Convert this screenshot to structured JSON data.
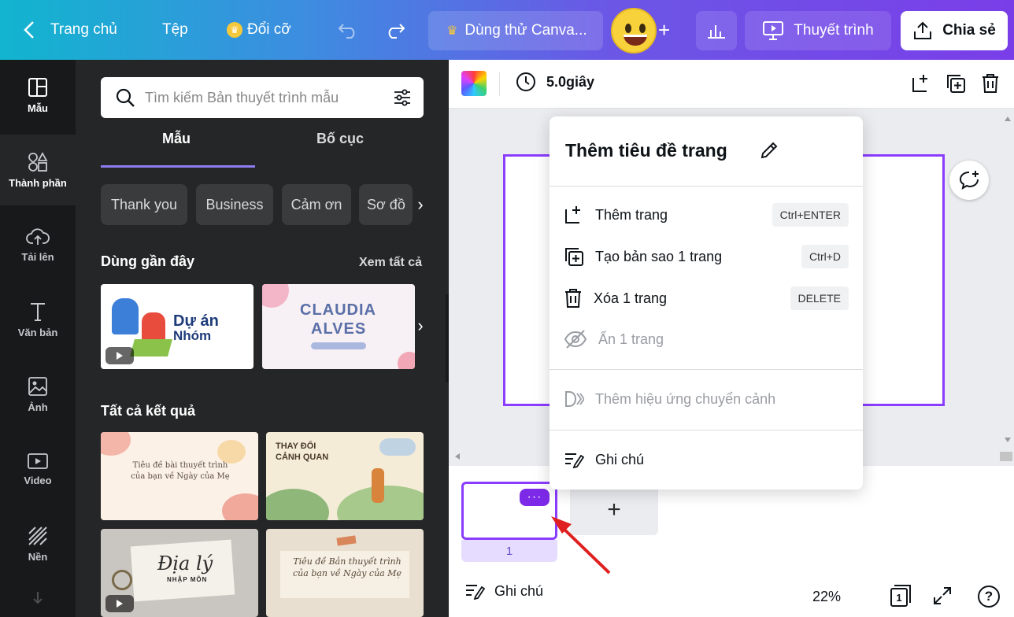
{
  "topbar": {
    "home_label": "Trang chủ",
    "file_label": "Tệp",
    "resize_label": "Đổi cỡ",
    "trial_label": "Dùng thử Canva...",
    "present_label": "Thuyết trình",
    "share_label": "Chia sẻ"
  },
  "rail": {
    "items": [
      {
        "label": "Mẫu",
        "icon": "template-icon"
      },
      {
        "label": "Thành phần",
        "icon": "elements-icon"
      },
      {
        "label": "Tải lên",
        "icon": "upload-icon"
      },
      {
        "label": "Văn bản",
        "icon": "text-icon"
      },
      {
        "label": "Ảnh",
        "icon": "photo-icon"
      },
      {
        "label": "Video",
        "icon": "video-icon"
      },
      {
        "label": "Nền",
        "icon": "background-icon"
      }
    ]
  },
  "panel": {
    "search_placeholder": "Tìm kiếm Bản thuyết trình mẫu",
    "tabs": [
      "Mẫu",
      "Bố cục"
    ],
    "chips": [
      "Thank you",
      "Business",
      "Cảm ơn",
      "Sơ đồ"
    ],
    "recent_title": "Dùng gần đây",
    "see_all": "Xem tất cả",
    "all_results_title": "Tất cả kết quả",
    "thumbs": {
      "t1_line1": "Dự án",
      "t1_line2": "Nhóm",
      "t2_line1": "CLAUDIA",
      "t2_line2": "ALVES",
      "t3_text": "Tiêu đề bài thuyết trình của bạn về Ngày của Mẹ",
      "t4_line1": "THAY ĐỔI",
      "t4_line2": "CẢNH QUAN",
      "t5_line1": "Địa lý",
      "t5_line2": "NHẬP MÔN",
      "t6_text": "Tiêu đề Bản thuyết trình của bạn về Ngày của Mẹ"
    }
  },
  "toolbar": {
    "duration": "5.0giây"
  },
  "menu": {
    "title": "Thêm tiêu đề trang",
    "items": [
      {
        "label": "Thêm trang",
        "shortcut": "Ctrl+ENTER"
      },
      {
        "label": "Tạo bản sao 1 trang",
        "shortcut": "Ctrl+D"
      },
      {
        "label": "Xóa 1 trang",
        "shortcut": "DELETE"
      },
      {
        "label": "Ẩn 1 trang",
        "shortcut": ""
      },
      {
        "label": "Thêm hiệu ứng chuyển cảnh",
        "shortcut": ""
      },
      {
        "label": "Ghi chú",
        "shortcut": ""
      }
    ]
  },
  "filmstrip": {
    "page_number": "1",
    "more_label": "···",
    "add_label": "+"
  },
  "bottombar": {
    "notes_label": "Ghi chú",
    "zoom": "22%",
    "page_count": "1"
  },
  "colors": {
    "accent": "#8b3dff",
    "more_button": "#7d2ae8",
    "panel_bg": "#252627",
    "rail_bg": "#18191b"
  }
}
